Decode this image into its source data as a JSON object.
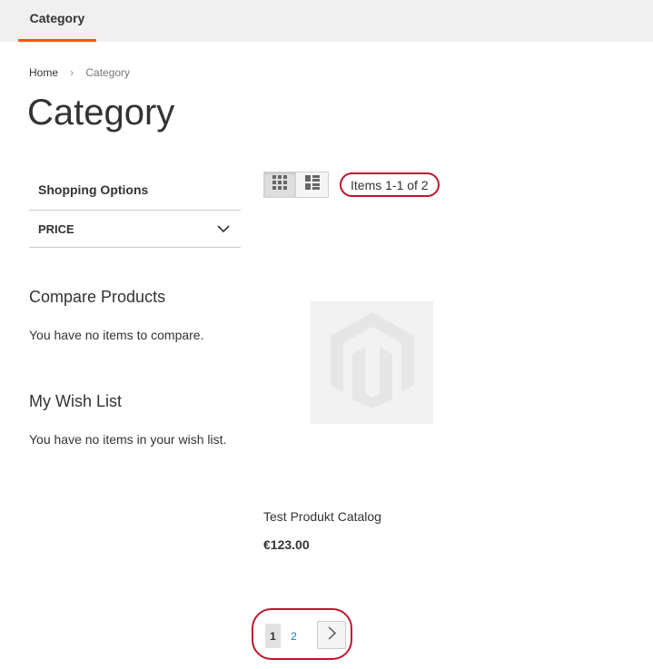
{
  "nav": {
    "category_tab": "Category"
  },
  "breadcrumb": {
    "home": "Home",
    "separator": "›",
    "current": "Category"
  },
  "page": {
    "title": "Category"
  },
  "sidebar": {
    "shopping_options": "Shopping Options",
    "filter_price": "PRICE",
    "compare": {
      "title": "Compare Products",
      "empty": "You have no items to compare."
    },
    "wishlist": {
      "title": "My Wish List",
      "empty": "You have no items in your wish list."
    }
  },
  "toolbar": {
    "grid_icon": "grid-icon",
    "list_icon": "list-icon",
    "items_count": "Items 1-1 of 2"
  },
  "product": {
    "placeholder_icon": "magento-logo-icon",
    "name": "Test Produkt Catalog",
    "price": "€123.00"
  },
  "pager": {
    "current_page": "1",
    "page_2": "2",
    "next_icon": "chevron-right-icon"
  },
  "colors": {
    "accent": "#ff5501",
    "highlight": "#c0162d",
    "link": "#1979c3"
  }
}
